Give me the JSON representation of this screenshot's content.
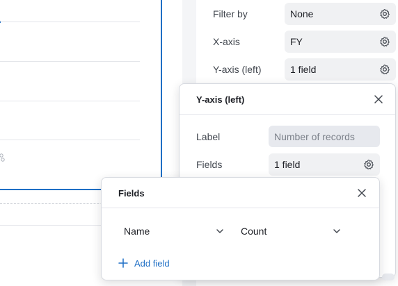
{
  "config": {
    "rows": [
      {
        "label": "Filter by",
        "value": "None"
      },
      {
        "label": "X-axis",
        "value": "FY"
      },
      {
        "label": "Y-axis (left)",
        "value": "1 field"
      }
    ]
  },
  "yaxis_popover": {
    "title": "Y-axis (left)",
    "label_label": "Label",
    "label_placeholder": "Number of records",
    "fields_label": "Fields",
    "fields_value": "1 field"
  },
  "fields_popover": {
    "title": "Fields",
    "field_name": "Name",
    "aggregation": "Count",
    "add_field_label": "Add field"
  },
  "colors": {
    "accent": "#1f6fc5",
    "panel_bg": "#f4f5f7",
    "field_bg": "#f0f1f3"
  },
  "icons": [
    "gear-icon",
    "close-icon",
    "chevron-down-icon",
    "plus-icon"
  ]
}
